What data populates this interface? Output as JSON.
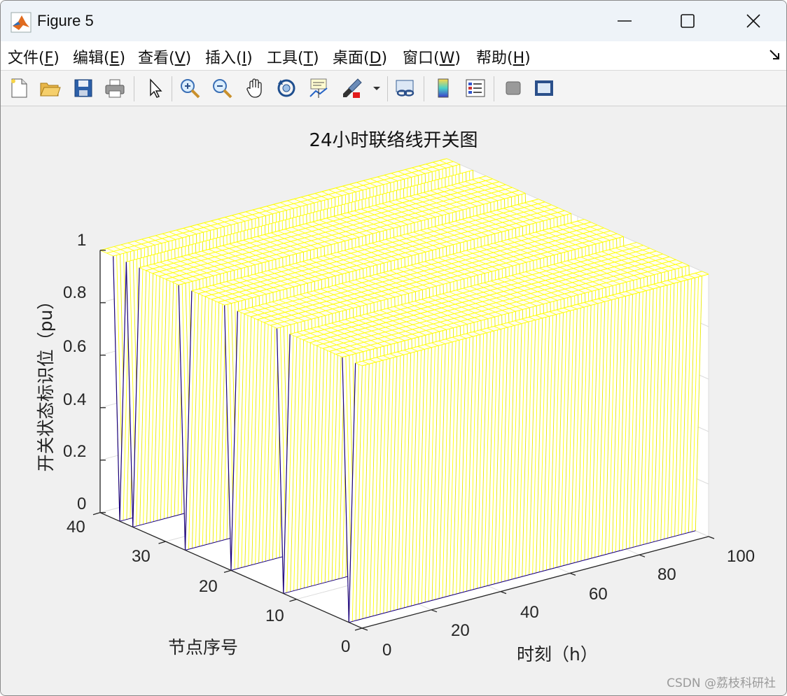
{
  "window": {
    "title": "Figure 5"
  },
  "menu": [
    {
      "label": "文件(",
      "key": "F",
      "suffix": ")"
    },
    {
      "label": "编辑(",
      "key": "E",
      "suffix": ")"
    },
    {
      "label": "查看(",
      "key": "V",
      "suffix": ")"
    },
    {
      "label": "插入(",
      "key": "I",
      "suffix": ")"
    },
    {
      "label": "工具(",
      "key": "T",
      "suffix": ")"
    },
    {
      "label": "桌面(",
      "key": "D",
      "suffix": ")"
    },
    {
      "label": "窗口(",
      "key": "W",
      "suffix": ")"
    },
    {
      "label": "帮助(",
      "key": "H",
      "suffix": ")"
    }
  ],
  "toolbar": {
    "icons": [
      "new-figure-icon",
      "open-folder-icon",
      "save-icon",
      "print-icon",
      "pointer-icon",
      "zoom-in-icon",
      "zoom-out-icon",
      "pan-hand-icon",
      "rotate-3d-icon",
      "data-cursor-icon",
      "brush-icon",
      "link-plot-icon",
      "colorbar-icon",
      "legend-icon",
      "hide-plot-tools-icon",
      "show-plot-tools-icon"
    ]
  },
  "chart_data": {
    "type": "surface",
    "title": "24小时联络线开关图",
    "xlabel": "时刻（h）",
    "ylabel": "节点序号",
    "zlabel": "开关状态标识位（pu）",
    "xlim": [
      0,
      100
    ],
    "ylim": [
      0,
      40
    ],
    "zlim": [
      0,
      1
    ],
    "xticks": [
      "0",
      "20",
      "40",
      "60",
      "80",
      "100"
    ],
    "yticks": [
      "0",
      "10",
      "20",
      "30",
      "40"
    ],
    "zticks": [
      "0",
      "0.2",
      "0.4",
      "0.6",
      "0.8",
      "1"
    ],
    "grid": true,
    "colors": {
      "high": "#ffff00",
      "low": "#1a0080"
    },
    "open_rows": [
      {
        "y": 2,
        "x": [
          0,
          100
        ]
      },
      {
        "y": 12,
        "x": [
          0,
          100
        ]
      },
      {
        "y": 20,
        "x": [
          0,
          100
        ]
      },
      {
        "y": 27,
        "x": [
          0,
          100
        ]
      },
      {
        "y": 35,
        "x": [
          0,
          100
        ]
      },
      {
        "y": 37,
        "x": [
          0,
          100
        ]
      }
    ]
  },
  "watermark": "CSDN @荔枝科研社"
}
